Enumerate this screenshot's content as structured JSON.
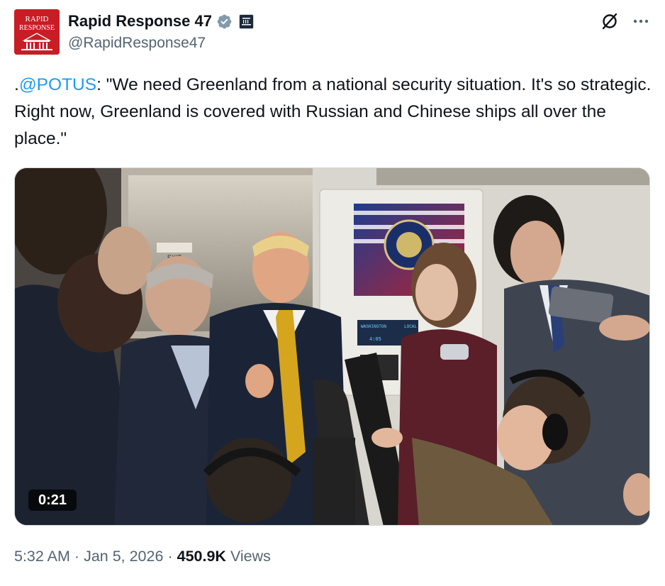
{
  "author": {
    "display_name": "Rapid Response 47",
    "handle": "@RapidResponse47",
    "avatar_text_line1": "RAPID",
    "avatar_text_line2": "RESPONSE",
    "avatar_color": "#c81d25",
    "verified_icon": "verified-badge-icon",
    "verified_color": "#829aab",
    "affiliation_icon": "white-house-affiliation-icon"
  },
  "actions": {
    "grok_icon": "grok-slash-icon",
    "more_icon": "more-horizontal-icon"
  },
  "tweet": {
    "prefix": ".",
    "mention": "@POTUS",
    "body": ": \"We need Greenland from a national security situation. It's so strategic. Right now, Greenland is covered with Russian and Chinese ships all over the place.\"",
    "mention_color": "#1d9bf0"
  },
  "media": {
    "duration": "0:21",
    "exit_sign": "EXIT",
    "screen_panel_label": "WASHINGTON",
    "screen_panel_label2": "LOCAL",
    "screen_panel_value": "4:05"
  },
  "footer": {
    "time": "5:32 AM",
    "separator": "·",
    "date": "Jan 5, 2026",
    "views_count": "450.9K",
    "views_label": "Views"
  }
}
